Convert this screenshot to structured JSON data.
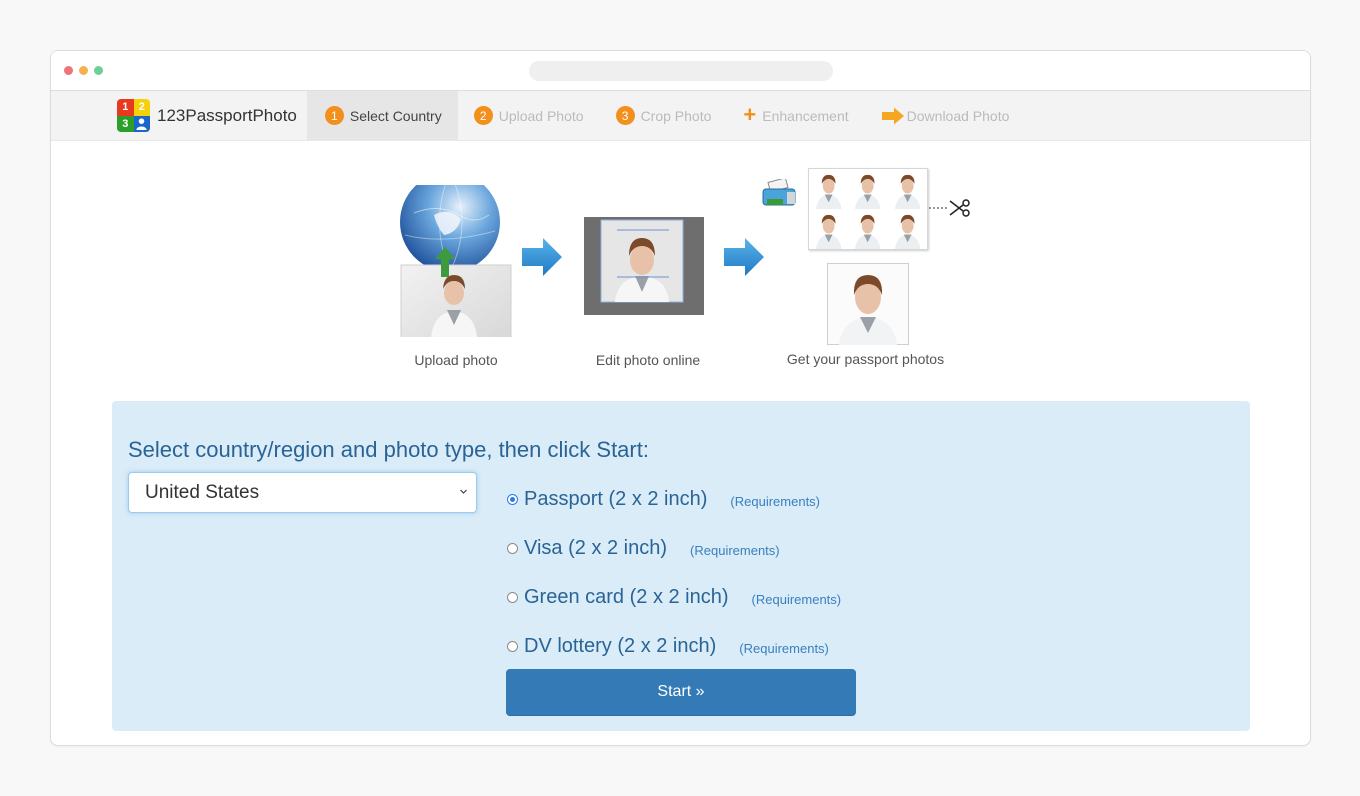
{
  "browser": {
    "window_controls": [
      "close",
      "minimize",
      "maximize"
    ]
  },
  "navbar": {
    "brand": "123PassportPhoto",
    "logo_digits": [
      "1",
      "2",
      "3"
    ],
    "steps": [
      {
        "icon": "step-number",
        "number": "1",
        "label": "Select Country",
        "active": true
      },
      {
        "icon": "step-number",
        "number": "2",
        "label": "Upload Photo",
        "active": false
      },
      {
        "icon": "step-number",
        "number": "3",
        "label": "Crop Photo",
        "active": false
      },
      {
        "icon": "plus-icon",
        "number": "+",
        "label": "Enhancement",
        "active": false
      },
      {
        "icon": "arrow-right-icon",
        "number": "",
        "label": "Download Photo",
        "active": false
      }
    ],
    "accent_color": "#f3901d"
  },
  "hero": {
    "stages": [
      {
        "label": "Upload photo",
        "illustration": "globe-upload-photo"
      },
      {
        "label": "Edit photo online",
        "illustration": "photo-editor-crop"
      },
      {
        "label": "Get your passport photos",
        "illustration": "printed-photo-sheet"
      }
    ]
  },
  "form": {
    "title": "Select country/region and photo type, then click Start:",
    "country": {
      "selected": "United States"
    },
    "photo_types": [
      {
        "label": "Passport (2 x 2 inch)",
        "link": "(Requirements)",
        "checked": true
      },
      {
        "label": "Visa (2 x 2 inch)",
        "link": "(Requirements)",
        "checked": false
      },
      {
        "label": "Green card (2 x 2 inch)",
        "link": "(Requirements)",
        "checked": false
      },
      {
        "label": "DV lottery (2 x 2 inch)",
        "link": "(Requirements)",
        "checked": false
      }
    ],
    "start_button": "Start »",
    "panel_color": "#d9ecf7",
    "button_color": "#337ab7"
  }
}
